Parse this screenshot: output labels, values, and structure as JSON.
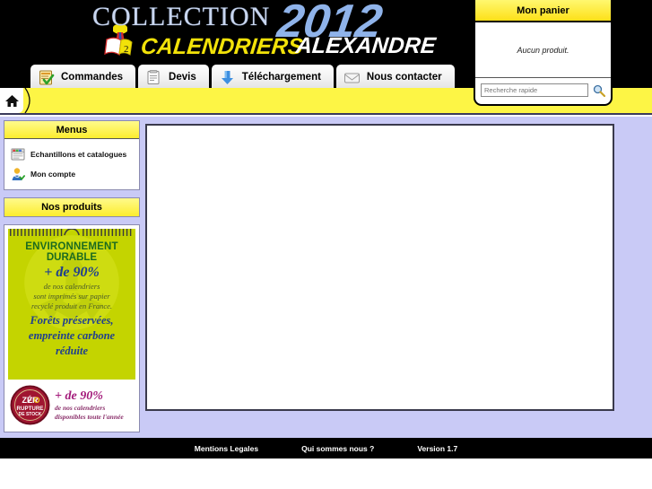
{
  "header": {
    "logo": {
      "collection": "COLLECTION",
      "year": "2012",
      "calendriers": "CALENDRIERS",
      "alexandre": "ALEXANDRE",
      "mascot_icon": "calendar-mascot-icon",
      "collection_color": "#c9d6ef",
      "year_color": "#8fb3ea",
      "calendriers_color": "#f2e209",
      "alexandre_color": "#ffffff",
      "background": "#000000"
    },
    "nav_tabs": [
      {
        "label": "Commandes",
        "icon": "clipboard-check-icon"
      },
      {
        "label": "Devis",
        "icon": "quote-document-icon"
      },
      {
        "label": "Téléchargement",
        "icon": "download-arrow-icon"
      },
      {
        "label": "Nous contacter",
        "icon": "envelope-icon"
      }
    ]
  },
  "breadcrumb": {
    "home_icon": "home-icon",
    "text": "",
    "background": "#fdf545"
  },
  "cart": {
    "title": "Mon panier",
    "empty_text": "Aucun produit.",
    "search": {
      "placeholder": "Recherche rapide",
      "value": "",
      "icon": "magnifier-icon"
    },
    "title_color": "#fde018"
  },
  "sidebar": {
    "menus_panel": {
      "title": "Menus",
      "items": [
        {
          "label": "Echantillons et catalogues",
          "icon": "catalog-window-icon"
        },
        {
          "label": "Mon compte",
          "icon": "user-account-icon"
        }
      ]
    },
    "products_panel": {
      "title": "Nos produits"
    },
    "promo": {
      "line1": "ENVIRONNEMENT",
      "line2": "DURABLE",
      "line3": "+ de 90%",
      "small1": "de nos calendriers",
      "small2": "sont imprimés sur papier",
      "small3": "recyclé produit en France.",
      "line4a": "Forêts préservées,",
      "line4b": "empreinte carbone",
      "line4c": "réduite",
      "background": "#c4d400",
      "recycle_icon": "recycle-symbol-icon"
    },
    "promo2": {
      "badge_line1": "ZÉRO",
      "badge_line2": "RUPTURE",
      "badge_line3": "DE STOCK",
      "badge_icon": "zero-rupture-badge-icon",
      "big": "+ de 90%",
      "small1": "de nos calendriers",
      "small2": "disponibles toute l'année",
      "badge_color": "#a01530"
    }
  },
  "main": {
    "content": ""
  },
  "footer": {
    "links": [
      {
        "label": "Mentions Legales"
      },
      {
        "label": "Qui sommes nous ?"
      },
      {
        "label": "Version 1.7"
      }
    ],
    "background": "#000000"
  }
}
